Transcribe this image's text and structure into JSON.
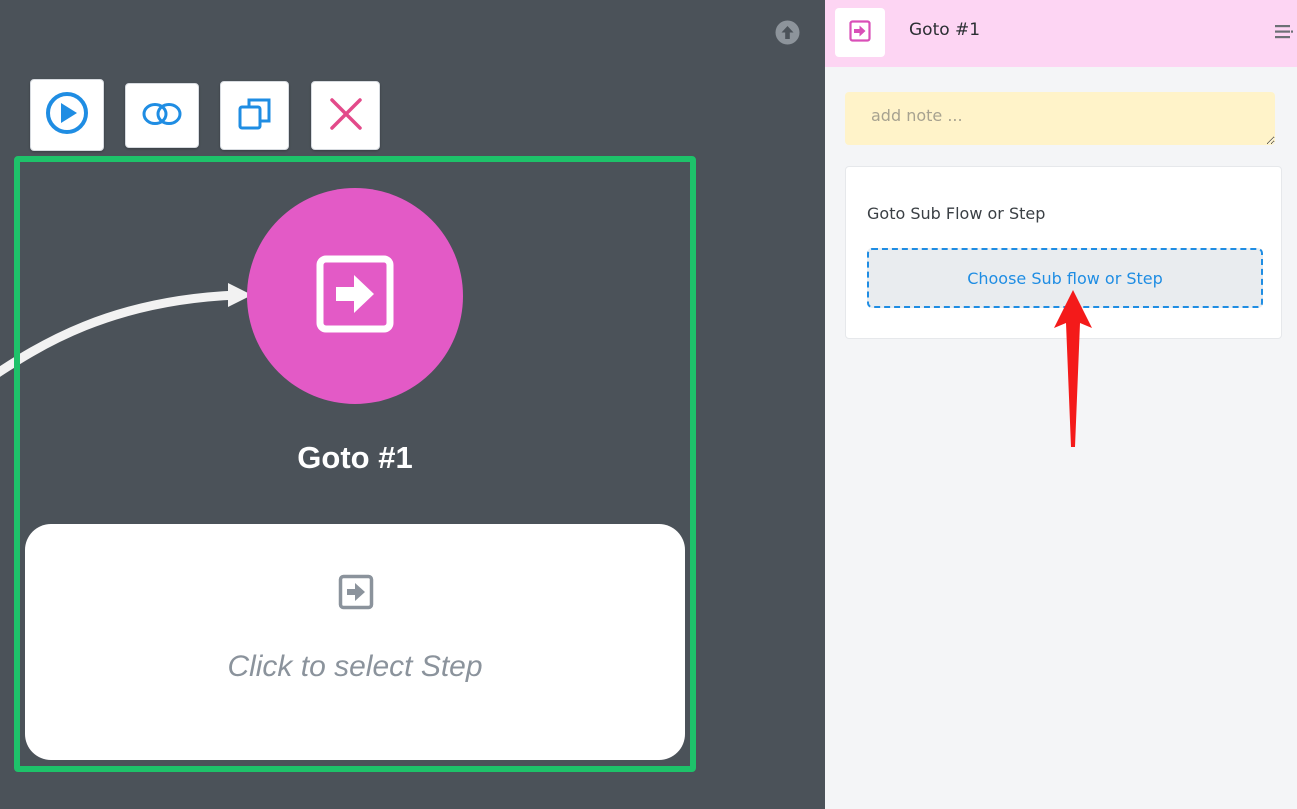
{
  "canvas": {
    "toolbar": {
      "run_icon": "play-circle-icon",
      "link_icon": "link-icon",
      "duplicate_icon": "duplicate-icon",
      "delete_icon": "close-icon"
    },
    "upload_icon": "arrow-up-circle-icon",
    "node": {
      "title": "Goto #1",
      "icon": "goto-arrow-icon",
      "color": "#e35ac6"
    },
    "step_card": {
      "icon": "goto-arrow-icon",
      "text": "Click to select Step"
    },
    "selection_color": "#1ec26a"
  },
  "panel": {
    "header": {
      "title": "Goto #1",
      "icon": "goto-arrow-icon",
      "menu_icon": "menu-icon",
      "background": "#fdd5f3"
    },
    "note": {
      "placeholder": "add note ...",
      "value": ""
    },
    "goto_section": {
      "label": "Goto Sub Flow or Step",
      "button_label": "Choose Sub flow or Step"
    }
  }
}
